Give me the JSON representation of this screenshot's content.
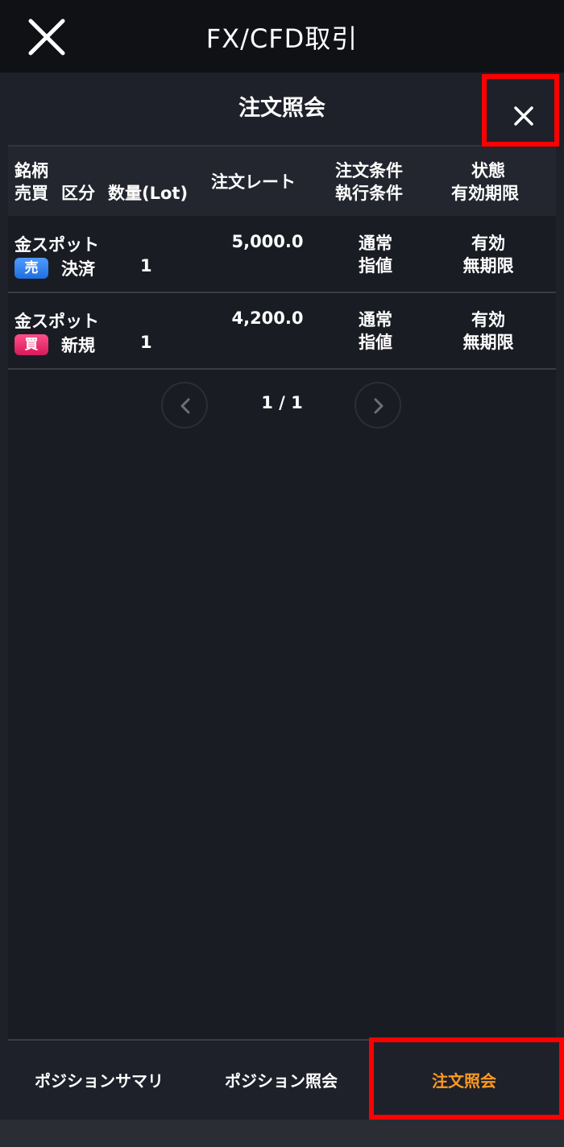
{
  "app": {
    "title": "FX/CFD取引"
  },
  "panel": {
    "title": "注文照会"
  },
  "table": {
    "headers": {
      "symbol": "銘柄",
      "side_kubun_qty": [
        "売買",
        "区分",
        "数量(Lot)"
      ],
      "rate": "注文レート",
      "conditions": [
        "注文条件",
        "執行条件"
      ],
      "status": [
        "状態",
        "有効期限"
      ]
    },
    "rows": [
      {
        "symbol": "金スポット",
        "side": "売",
        "kubun": "決済",
        "qty": "1",
        "rate": "5,000.0",
        "order_cond": "通常",
        "exec_cond": "指値",
        "state": "有効",
        "expiry": "無期限"
      },
      {
        "symbol": "金スポット",
        "side": "買",
        "kubun": "新規",
        "qty": "1",
        "rate": "4,200.0",
        "order_cond": "通常",
        "exec_cond": "指値",
        "state": "有効",
        "expiry": "無期限"
      }
    ]
  },
  "pager": {
    "text": "1 / 1"
  },
  "tabs": [
    {
      "label": "ポジションサマリ"
    },
    {
      "label": "ポジション照会"
    },
    {
      "label": "注文照会"
    }
  ],
  "colors": {
    "sell": "#2f80ff",
    "buy": "#e8246a",
    "active_tab": "#ff9a1f",
    "highlight": "#ff0000"
  }
}
